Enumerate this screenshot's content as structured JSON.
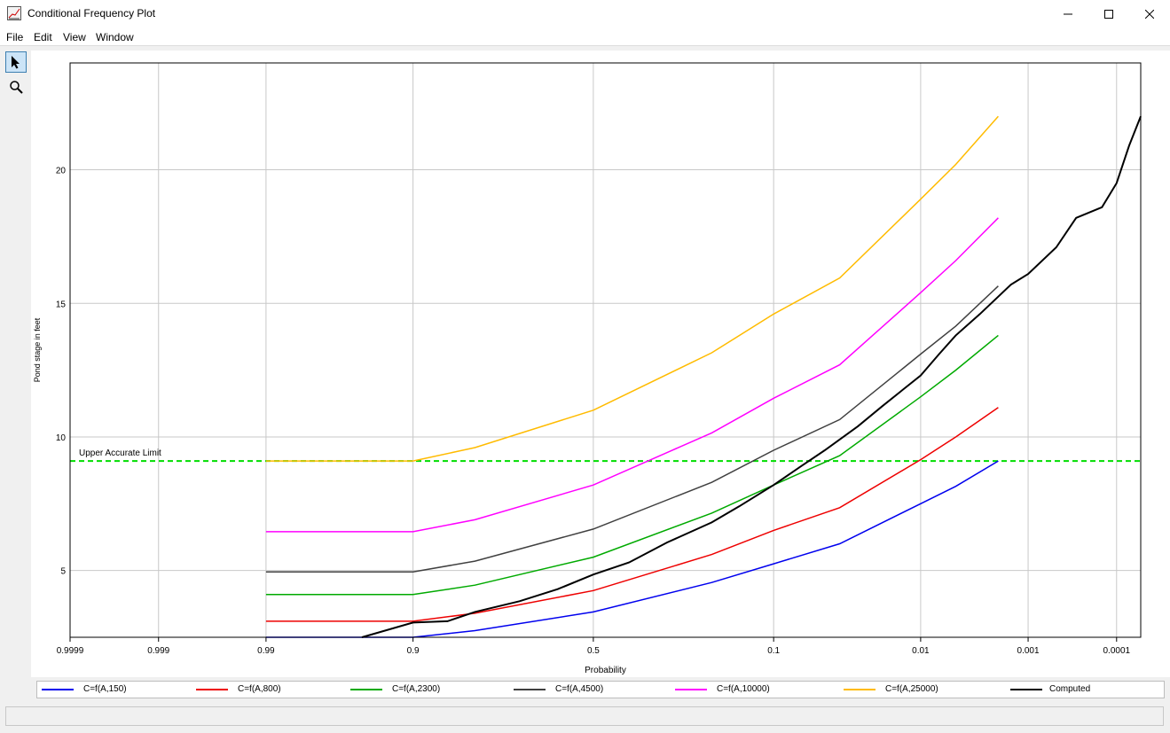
{
  "window": {
    "title": "Conditional Frequency Plot"
  },
  "menu": {
    "items": [
      "File",
      "Edit",
      "View",
      "Window"
    ]
  },
  "toolbar": {
    "tools": [
      "pointer-icon",
      "zoom-icon"
    ]
  },
  "chart_data": {
    "type": "line",
    "x_scale": "normal-probability (exceedance)",
    "xlabel": "Probability",
    "ylabel": "Pond stage in feet",
    "x_ticks": [
      0.9999,
      0.999,
      0.99,
      0.9,
      0.5,
      0.1,
      0.01,
      0.001,
      0.0001
    ],
    "x_tick_labels": [
      "0.9999",
      "0.999",
      "0.99",
      "0.9",
      "0.5",
      "0.1",
      "0.01",
      "0.001",
      "0.0001"
    ],
    "xlim": [
      0.9999,
      5e-05
    ],
    "y_ticks": [
      5,
      10,
      15,
      20
    ],
    "y_tick_labels": [
      "5",
      "10",
      "15",
      "20"
    ],
    "ylim": [
      2.5,
      24
    ],
    "grid": true,
    "legend_position": "bottom",
    "reference_lines": [
      {
        "label": "Upper Accurate Limit",
        "y": 9.1,
        "color": "#00dd00",
        "style": "dashed"
      }
    ],
    "series": [
      {
        "name": "C=f(A,150)",
        "color": "#0000ee",
        "points": [
          [
            0.99,
            2.5
          ],
          [
            0.9,
            2.5
          ],
          [
            0.8,
            2.75
          ],
          [
            0.5,
            3.45
          ],
          [
            0.2,
            4.55
          ],
          [
            0.1,
            5.25
          ],
          [
            0.04,
            6.0
          ],
          [
            0.01,
            7.5
          ],
          [
            0.005,
            8.15
          ],
          [
            0.002,
            9.1
          ]
        ]
      },
      {
        "name": "C=f(A,800)",
        "color": "#ee0000",
        "points": [
          [
            0.99,
            3.1
          ],
          [
            0.9,
            3.1
          ],
          [
            0.8,
            3.4
          ],
          [
            0.5,
            4.25
          ],
          [
            0.2,
            5.6
          ],
          [
            0.1,
            6.5
          ],
          [
            0.04,
            7.35
          ],
          [
            0.01,
            9.15
          ],
          [
            0.005,
            10.0
          ],
          [
            0.002,
            11.1
          ]
        ]
      },
      {
        "name": "C=f(A,2300)",
        "color": "#00aa00",
        "points": [
          [
            0.99,
            4.1
          ],
          [
            0.9,
            4.1
          ],
          [
            0.8,
            4.45
          ],
          [
            0.5,
            5.5
          ],
          [
            0.2,
            7.15
          ],
          [
            0.1,
            8.2
          ],
          [
            0.04,
            9.3
          ],
          [
            0.01,
            11.5
          ],
          [
            0.005,
            12.5
          ],
          [
            0.002,
            13.8
          ]
        ]
      },
      {
        "name": "C=f(A,4500)",
        "color": "#404040",
        "points": [
          [
            0.99,
            4.95
          ],
          [
            0.9,
            4.95
          ],
          [
            0.8,
            5.35
          ],
          [
            0.5,
            6.55
          ],
          [
            0.2,
            8.3
          ],
          [
            0.1,
            9.5
          ],
          [
            0.04,
            10.65
          ],
          [
            0.01,
            13.1
          ],
          [
            0.005,
            14.15
          ],
          [
            0.002,
            15.65
          ]
        ]
      },
      {
        "name": "C=f(A,10000)",
        "color": "#ff00ff",
        "points": [
          [
            0.99,
            6.45
          ],
          [
            0.9,
            6.45
          ],
          [
            0.8,
            6.9
          ],
          [
            0.5,
            8.2
          ],
          [
            0.2,
            10.15
          ],
          [
            0.1,
            11.45
          ],
          [
            0.04,
            12.7
          ],
          [
            0.01,
            15.4
          ],
          [
            0.005,
            16.6
          ],
          [
            0.002,
            18.2
          ]
        ]
      },
      {
        "name": "C=f(A,25000)",
        "color": "#ffbb00",
        "points": [
          [
            0.99,
            9.1
          ],
          [
            0.9,
            9.1
          ],
          [
            0.8,
            9.6
          ],
          [
            0.5,
            11.0
          ],
          [
            0.2,
            13.15
          ],
          [
            0.1,
            14.6
          ],
          [
            0.04,
            15.95
          ],
          [
            0.01,
            18.9
          ],
          [
            0.005,
            20.2
          ],
          [
            0.002,
            22.0
          ]
        ]
      },
      {
        "name": "Computed",
        "color": "#000000",
        "points": [
          [
            0.95,
            2.5
          ],
          [
            0.9,
            3.05
          ],
          [
            0.85,
            3.1
          ],
          [
            0.8,
            3.45
          ],
          [
            0.7,
            3.85
          ],
          [
            0.6,
            4.3
          ],
          [
            0.5,
            4.85
          ],
          [
            0.4,
            5.3
          ],
          [
            0.3,
            6.05
          ],
          [
            0.2,
            6.8
          ],
          [
            0.15,
            7.4
          ],
          [
            0.1,
            8.2
          ],
          [
            0.07,
            8.9
          ],
          [
            0.05,
            9.5
          ],
          [
            0.03,
            10.4
          ],
          [
            0.02,
            11.15
          ],
          [
            0.01,
            12.3
          ],
          [
            0.007,
            13.1
          ],
          [
            0.005,
            13.8
          ],
          [
            0.003,
            14.6
          ],
          [
            0.0015,
            15.7
          ],
          [
            0.001,
            16.1
          ],
          [
            0.0005,
            17.1
          ],
          [
            0.0003,
            18.2
          ],
          [
            0.00015,
            18.6
          ],
          [
            0.0001,
            19.5
          ],
          [
            7e-05,
            20.9
          ],
          [
            5e-05,
            22.0
          ]
        ]
      }
    ]
  }
}
